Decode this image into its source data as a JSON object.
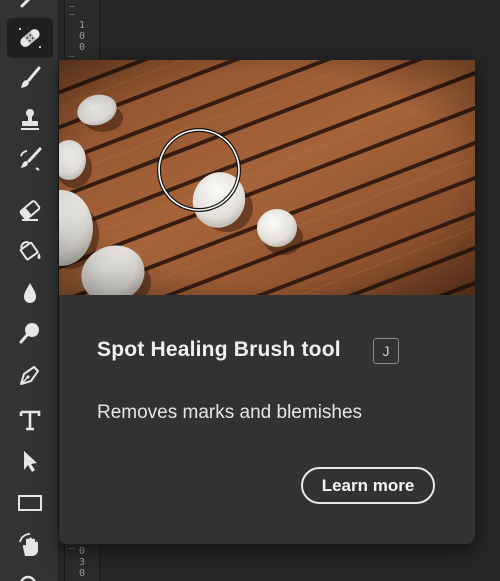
{
  "tooltip": {
    "title": "Spot Healing Brush tool",
    "shortcut": "J",
    "description": "Removes marks and blemishes",
    "learn_more_label": "Learn more"
  },
  "ruler": {
    "top_label": "1\n0\n0",
    "bottom_label": "0\n3\n0"
  },
  "tools": [
    {
      "name": "healing-brush-icon",
      "selected": false
    },
    {
      "name": "spot-healing-brush-icon",
      "selected": true
    },
    {
      "name": "brush-icon",
      "selected": false
    },
    {
      "name": "clone-stamp-icon",
      "selected": false
    },
    {
      "name": "history-brush-icon",
      "selected": false
    },
    {
      "name": "eraser-icon",
      "selected": false
    },
    {
      "name": "paint-bucket-icon",
      "selected": false
    },
    {
      "name": "blur-icon",
      "selected": false
    },
    {
      "name": "dodge-icon",
      "selected": false
    },
    {
      "name": "pen-icon",
      "selected": false
    },
    {
      "name": "type-icon",
      "selected": false
    },
    {
      "name": "path-selection-icon",
      "selected": false
    },
    {
      "name": "rectangle-icon",
      "selected": false
    },
    {
      "name": "hand-icon",
      "selected": false
    },
    {
      "name": "zoom-icon",
      "selected": false
    }
  ],
  "colors": {
    "panel_bg": "#333333",
    "tooltip_bg": "#323232",
    "wood": "#9a5a33"
  }
}
